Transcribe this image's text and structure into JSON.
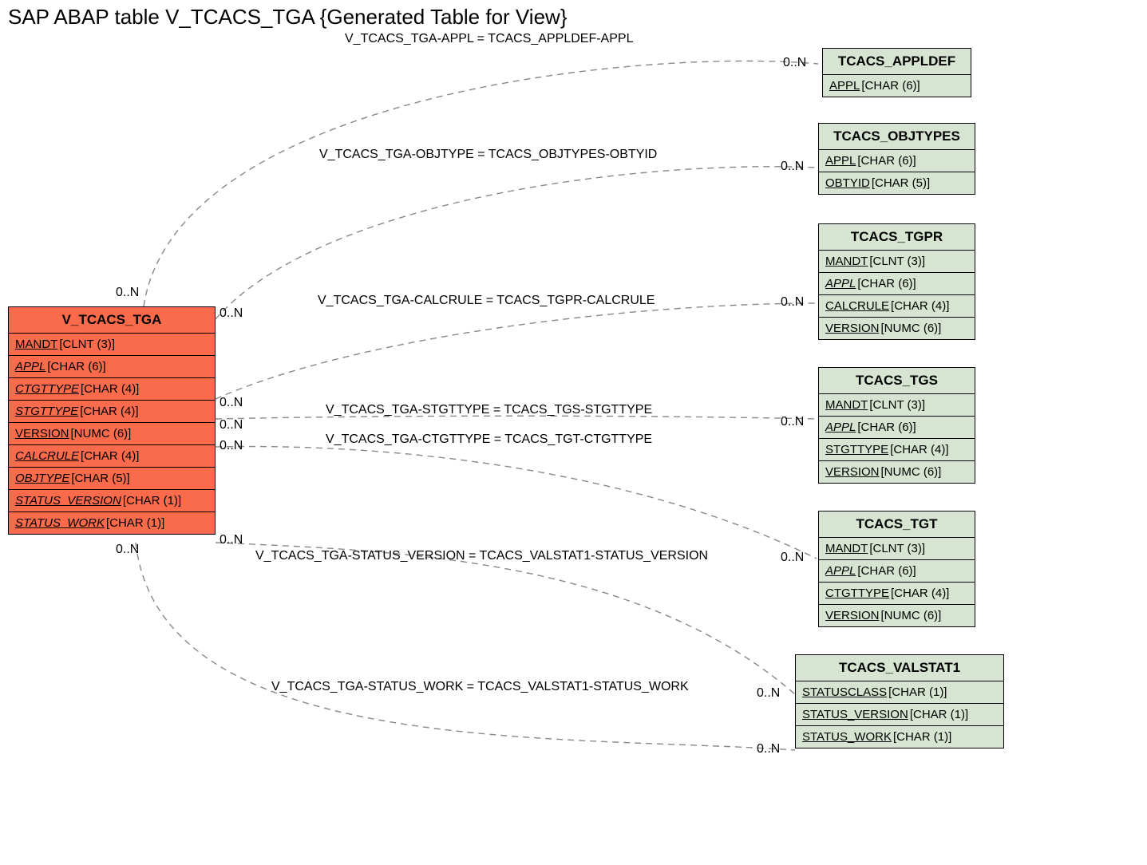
{
  "title": "SAP ABAP table V_TCACS_TGA {Generated Table for View}",
  "mainEntity": {
    "name": "V_TCACS_TGA",
    "fields": [
      {
        "name": "MANDT",
        "type": "[CLNT (3)]",
        "italic": false
      },
      {
        "name": "APPL",
        "type": "[CHAR (6)]",
        "italic": true
      },
      {
        "name": "CTGTTYPE",
        "type": "[CHAR (4)]",
        "italic": true
      },
      {
        "name": "STGTTYPE",
        "type": "[CHAR (4)]",
        "italic": true
      },
      {
        "name": "VERSION",
        "type": "[NUMC (6)]",
        "italic": false
      },
      {
        "name": "CALCRULE",
        "type": "[CHAR (4)]",
        "italic": true
      },
      {
        "name": "OBJTYPE",
        "type": "[CHAR (5)]",
        "italic": true
      },
      {
        "name": "STATUS_VERSION",
        "type": "[CHAR (1)]",
        "italic": true
      },
      {
        "name": "STATUS_WORK",
        "type": "[CHAR (1)]",
        "italic": true
      }
    ]
  },
  "entities": [
    {
      "name": "TCACS_APPLDEF",
      "fields": [
        {
          "name": "APPL",
          "type": "[CHAR (6)]",
          "italic": false
        }
      ]
    },
    {
      "name": "TCACS_OBJTYPES",
      "fields": [
        {
          "name": "APPL",
          "type": "[CHAR (6)]",
          "italic": false
        },
        {
          "name": "OBTYID",
          "type": "[CHAR (5)]",
          "italic": false
        }
      ]
    },
    {
      "name": "TCACS_TGPR",
      "fields": [
        {
          "name": "MANDT",
          "type": "[CLNT (3)]",
          "italic": false
        },
        {
          "name": "APPL",
          "type": "[CHAR (6)]",
          "italic": true
        },
        {
          "name": "CALCRULE",
          "type": "[CHAR (4)]",
          "italic": false
        },
        {
          "name": "VERSION",
          "type": "[NUMC (6)]",
          "italic": false
        }
      ]
    },
    {
      "name": "TCACS_TGS",
      "fields": [
        {
          "name": "MANDT",
          "type": "[CLNT (3)]",
          "italic": false
        },
        {
          "name": "APPL",
          "type": "[CHAR (6)]",
          "italic": true
        },
        {
          "name": "STGTTYPE",
          "type": "[CHAR (4)]",
          "italic": false
        },
        {
          "name": "VERSION",
          "type": "[NUMC (6)]",
          "italic": false
        }
      ]
    },
    {
      "name": "TCACS_TGT",
      "fields": [
        {
          "name": "MANDT",
          "type": "[CLNT (3)]",
          "italic": false
        },
        {
          "name": "APPL",
          "type": "[CHAR (6)]",
          "italic": true
        },
        {
          "name": "CTGTTYPE",
          "type": "[CHAR (4)]",
          "italic": false
        },
        {
          "name": "VERSION",
          "type": "[NUMC (6)]",
          "italic": false
        }
      ]
    },
    {
      "name": "TCACS_VALSTAT1",
      "fields": [
        {
          "name": "STATUSCLASS",
          "type": "[CHAR (1)]",
          "italic": false
        },
        {
          "name": "STATUS_VERSION",
          "type": "[CHAR (1)]",
          "italic": false
        },
        {
          "name": "STATUS_WORK",
          "type": "[CHAR (1)]",
          "italic": false
        }
      ]
    }
  ],
  "relations": [
    {
      "text": "V_TCACS_TGA-APPL = TCACS_APPLDEF-APPL"
    },
    {
      "text": "V_TCACS_TGA-OBJTYPE = TCACS_OBJTYPES-OBTYID"
    },
    {
      "text": "V_TCACS_TGA-CALCRULE = TCACS_TGPR-CALCRULE"
    },
    {
      "text": "V_TCACS_TGA-STGTTYPE = TCACS_TGS-STGTTYPE"
    },
    {
      "text": "V_TCACS_TGA-CTGTTYPE = TCACS_TGT-CTGTTYPE"
    },
    {
      "text": "V_TCACS_TGA-STATUS_VERSION = TCACS_VALSTAT1-STATUS_VERSION"
    },
    {
      "text": "V_TCACS_TGA-STATUS_WORK = TCACS_VALSTAT1-STATUS_WORK"
    }
  ],
  "cardinalities": {
    "zeroN": "0..N"
  }
}
